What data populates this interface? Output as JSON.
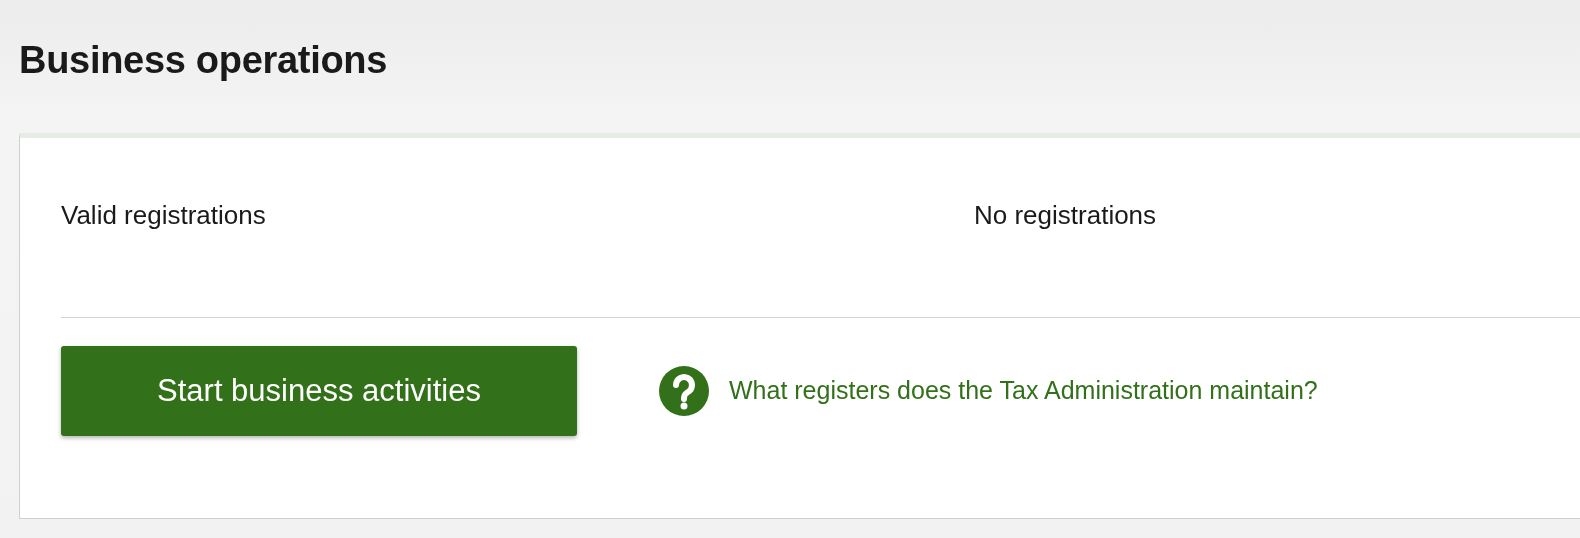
{
  "page_title": "Business operations",
  "registrations": {
    "label": "Valid registrations",
    "value": "No registrations"
  },
  "action_button": {
    "label": "Start business activities"
  },
  "help_link": {
    "label": "What registers does the Tax Administration maintain?"
  }
}
